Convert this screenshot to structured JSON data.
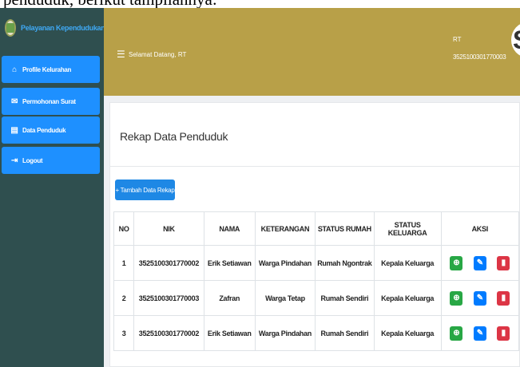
{
  "doc_text": "penduduk, berikut tampilannya:",
  "brand": {
    "title": "Pelayanan Kependudukan",
    "logo_icon": "emblem-icon"
  },
  "sidebar": {
    "items": [
      {
        "label": "Profile Kelurahan",
        "icon": "home-icon",
        "glyph": "⌂"
      },
      {
        "label": "Permohonan Surat",
        "icon": "letter-icon",
        "glyph": "✉"
      },
      {
        "label": "Data Penduduk",
        "icon": "file-icon",
        "glyph": "▤"
      },
      {
        "label": "Logout",
        "icon": "logout-icon",
        "glyph": "⇥"
      }
    ]
  },
  "header": {
    "menu_glyph": "☰",
    "welcome": "Selamat Datang, RT",
    "role": "RT",
    "nik": "3525100301770003",
    "avatar_letter": "S"
  },
  "page": {
    "title": "Rekap Data Penduduk",
    "add_button": "+ Tambah Data Rekap"
  },
  "table": {
    "headers": [
      "NO",
      "NIK",
      "NAMA",
      "KETERANGAN",
      "STATUS RUMAH",
      "STATUS KELUARGA",
      "AKSI"
    ],
    "rows": [
      {
        "no": "1",
        "nik": "3525100301770002",
        "nama": "Erik Setiawan",
        "keterangan": "Warga Pindahan",
        "status_rumah": "Rumah Ngontrak",
        "status_keluarga": "Kepala Keluarga"
      },
      {
        "no": "2",
        "nik": "3525100301770003",
        "nama": "Zafran",
        "keterangan": "Warga Tetap",
        "status_rumah": "Rumah Sendiri",
        "status_keluarga": "Kepala Keluarga"
      },
      {
        "no": "3",
        "nik": "3525100301770002",
        "nama": "Erik Setiawan",
        "keterangan": "Warga Pindahan",
        "status_rumah": "Rumah Sendiri",
        "status_keluarga": "Kepala Keluarga"
      }
    ],
    "actions": {
      "view_glyph": "⊕",
      "edit_glyph": "✎",
      "delete_glyph": "▮"
    }
  },
  "colors": {
    "sidebar_bg": "#2f4f4f",
    "nav_item_bg": "#1e90ff",
    "topbar_bg": "#b8a048",
    "view_button": "#28a745",
    "edit_button": "#007bff",
    "delete_button": "#dc3545"
  }
}
